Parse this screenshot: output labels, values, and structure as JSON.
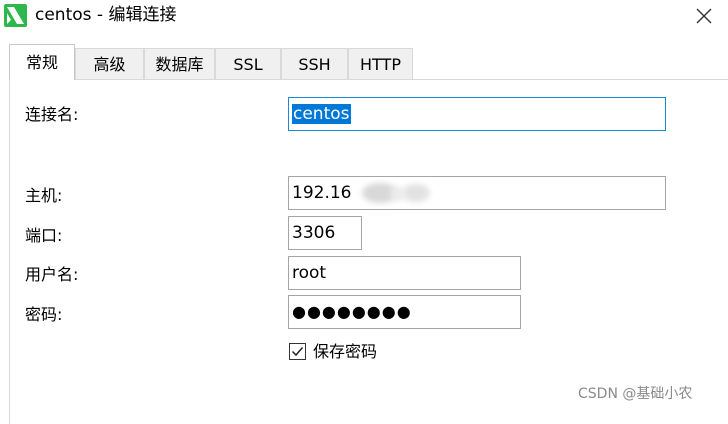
{
  "window": {
    "title": "centos - 编辑连接",
    "icon": "navicat-icon",
    "close_icon": "close-icon"
  },
  "tabs": [
    {
      "label": "常规",
      "active": true
    },
    {
      "label": "高级",
      "active": false
    },
    {
      "label": "数据库",
      "active": false
    },
    {
      "label": "SSL",
      "active": false
    },
    {
      "label": "SSH",
      "active": false
    },
    {
      "label": "HTTP",
      "active": false
    }
  ],
  "form": {
    "connection_name_label": "连接名:",
    "connection_name_value": "centos",
    "host_label": "主机:",
    "host_value": "192.16",
    "port_label": "端口:",
    "port_value": "3306",
    "username_label": "用户名:",
    "username_value": "root",
    "password_label": "密码:",
    "password_value": "●●●●●●●●",
    "save_password_label": "保存密码",
    "save_password_checked": true
  },
  "watermark": "CSDN @基础小农",
  "colors": {
    "selection": "#0078d7",
    "focus_border": "#1a8ad9",
    "icon_green": "#2eb84b"
  }
}
